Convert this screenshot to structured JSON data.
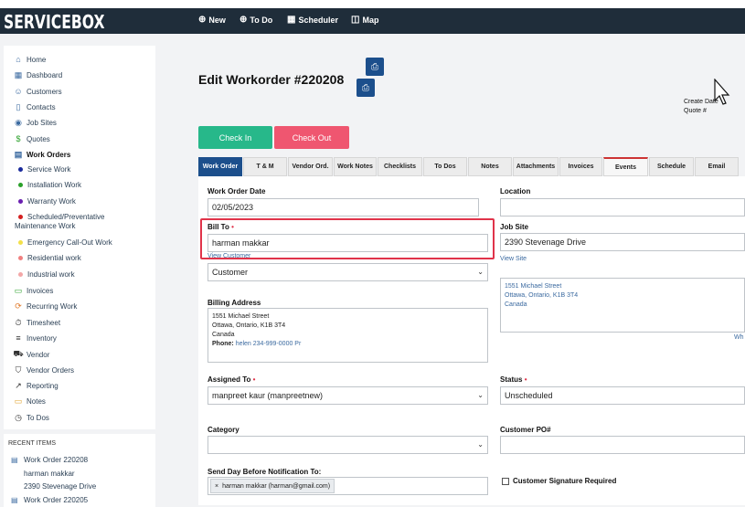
{
  "header": {
    "logo": "SERVICEBOX",
    "nav": [
      {
        "label": "New",
        "icon": "plus-circle-icon"
      },
      {
        "label": "To Do",
        "icon": "plus-circle-icon"
      },
      {
        "label": "Scheduler",
        "icon": "calendar-icon"
      },
      {
        "label": "Map",
        "icon": "map-icon"
      }
    ]
  },
  "sidebar": {
    "items": [
      {
        "label": "Home",
        "icon": "home-icon"
      },
      {
        "label": "Dashboard",
        "icon": "dashboard-icon"
      },
      {
        "label": "Customers",
        "icon": "users-icon"
      },
      {
        "label": "Contacts",
        "icon": "contacts-icon"
      },
      {
        "label": "Job Sites",
        "icon": "location-pin-icon"
      },
      {
        "label": "Quotes",
        "icon": "dollar-icon"
      },
      {
        "label": "Work Orders",
        "icon": "document-icon"
      }
    ],
    "work_order_types": [
      {
        "label": "Service Work",
        "color": "#1a2a9c"
      },
      {
        "label": "Installation Work",
        "color": "#2aa02a"
      },
      {
        "label": "Warranty Work",
        "color": "#6a1fb0"
      },
      {
        "label": "Scheduled/Preventative",
        "label2": "Maintenance Work",
        "color": "#d42020"
      },
      {
        "label": "Emergency Call-Out Work",
        "color": "#f3e04a"
      },
      {
        "label": "Residential work",
        "color": "#f08080"
      },
      {
        "label": "Industrial work",
        "color": "#f3a7a7"
      }
    ],
    "items2": [
      {
        "label": "Invoices",
        "icon": "invoice-icon"
      },
      {
        "label": "Recurring Work",
        "icon": "recurring-icon"
      },
      {
        "label": "Timesheet",
        "icon": "stopwatch-icon"
      },
      {
        "label": "Inventory",
        "icon": "list-icon"
      },
      {
        "label": "Vendor",
        "icon": "truck-icon"
      },
      {
        "label": "Vendor Orders",
        "icon": "cart-icon"
      },
      {
        "label": "Reporting",
        "icon": "chart-line-icon"
      },
      {
        "label": "Notes",
        "icon": "note-icon"
      },
      {
        "label": "To Dos",
        "icon": "clock-icon"
      }
    ]
  },
  "recent": {
    "heading": "RECENT ITEMS",
    "items": [
      {
        "title": "Work Order 220208",
        "line1": "harman makkar",
        "line2": "2390 Stevenage Drive"
      },
      {
        "title": "Work Order 220205"
      }
    ]
  },
  "page": {
    "title": "Edit Workorder #220208",
    "create_line1": "Create Date",
    "create_line2": "Quote #",
    "check_in": "Check In",
    "check_out": "Check Out"
  },
  "tabs": [
    "Work Order",
    "T & M",
    "Vendor Ord.",
    "Work Notes",
    "Checklists",
    "To Dos",
    "Notes",
    "Attachments",
    "Invoices",
    "Events",
    "Schedule",
    "Email"
  ],
  "form": {
    "work_order_date_label": "Work Order Date",
    "work_order_date": "02/05/2023",
    "location_label": "Location",
    "location_value": "",
    "bill_to_label": "Bill To",
    "bill_to_value": "harman makkar",
    "view_customer": "View Customer",
    "customer_type": "Customer",
    "job_site_label": "Job Site",
    "job_site_value": "2390 Stevenage Drive",
    "view_site": "View Site",
    "site_address": [
      "1551 Michael Street",
      "Ottawa, Ontario, K1B 3T4",
      "Canada"
    ],
    "billing_address_label": "Billing Address",
    "billing_address": [
      "1551 Michael Street",
      "Ottawa, Ontario, K1B 3T4",
      "Canada"
    ],
    "phone_label": "Phone:",
    "phone_value": "helen 234-999-0000 Pr",
    "partial_link": "Wh",
    "assigned_to_label": "Assigned To",
    "assigned_to_value": "manpreet kaur (manpreetnew)",
    "status_label": "Status",
    "status_value": "Unscheduled",
    "category_label": "Category",
    "category_value": "",
    "customer_po_label": "Customer PO#",
    "customer_po_value": "",
    "notification_label": "Send Day Before Notification To:",
    "notification_chip": "harman makkar (harman@gmail.com)",
    "signature_label": "Customer Signature Required"
  }
}
